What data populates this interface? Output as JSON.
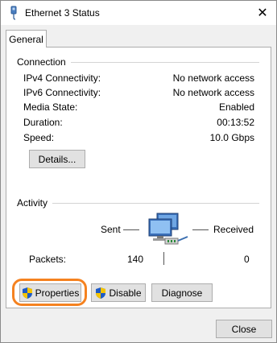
{
  "window": {
    "title": "Ethernet 3 Status",
    "close_glyph": "✕"
  },
  "tabs": [
    {
      "label": "General"
    }
  ],
  "connection": {
    "group_label": "Connection",
    "rows": [
      {
        "label": "IPv4 Connectivity:",
        "value": "No network access"
      },
      {
        "label": "IPv6 Connectivity:",
        "value": "No network access"
      },
      {
        "label": "Media State:",
        "value": "Enabled"
      },
      {
        "label": "Duration:",
        "value": "00:13:52"
      },
      {
        "label": "Speed:",
        "value": "10.0 Gbps"
      }
    ],
    "details_button": "Details..."
  },
  "activity": {
    "group_label": "Activity",
    "sent_label": "Sent",
    "received_label": "Received",
    "packets_label": "Packets:",
    "packets_sent": "140",
    "packets_received": "0"
  },
  "actions": {
    "properties": "Properties",
    "disable": "Disable",
    "diagnose": "Diagnose"
  },
  "footer": {
    "close": "Close"
  },
  "colors": {
    "highlight": "#f58220",
    "shield_blue": "#1e5bc6",
    "shield_yellow": "#f5c400"
  }
}
